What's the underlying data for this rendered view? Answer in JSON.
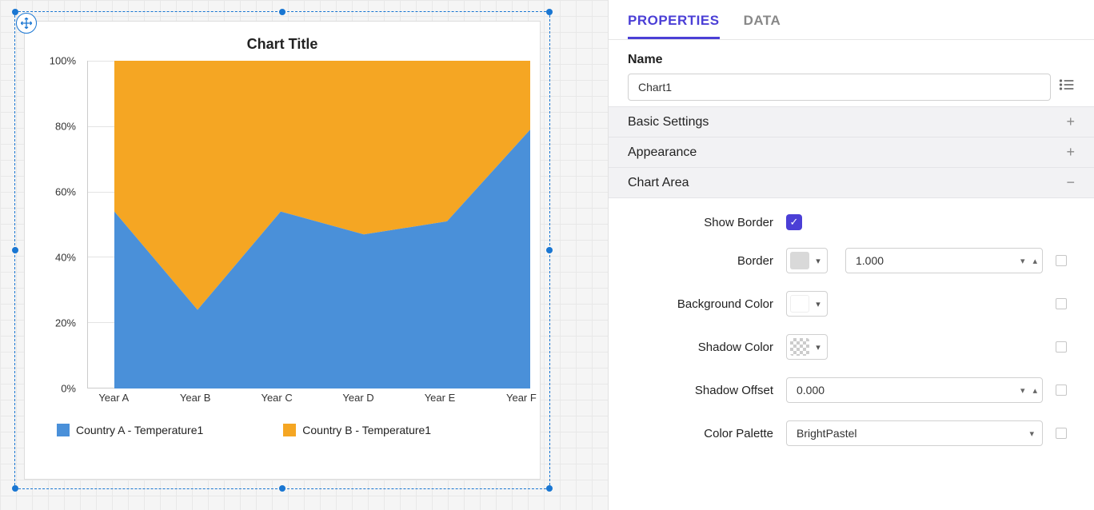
{
  "chart": {
    "title": "Chart Title",
    "y_ticks": [
      "0%",
      "20%",
      "40%",
      "60%",
      "80%",
      "100%"
    ],
    "x_ticks": [
      "Year A",
      "Year B",
      "Year C",
      "Year D",
      "Year E",
      "Year F"
    ],
    "legend": {
      "a": "Country A - Temperature1",
      "b": "Country B - Temperature1"
    }
  },
  "tabs": {
    "properties": "PROPERTIES",
    "data": "DATA"
  },
  "name_section": {
    "label": "Name",
    "value": "Chart1"
  },
  "accordion": {
    "basic": "Basic Settings",
    "appearance": "Appearance",
    "chart_area": "Chart Area"
  },
  "chart_area": {
    "show_border": "Show Border",
    "border": "Border",
    "border_width": "1.000",
    "background_color": "Background Color",
    "shadow_color": "Shadow Color",
    "shadow_offset": "Shadow Offset",
    "shadow_offset_val": "0.000",
    "color_palette": "Color Palette",
    "color_palette_val": "BrightPastel"
  },
  "colors": {
    "series_a": "#4a90d9",
    "series_b": "#f5a623",
    "accent": "#4b3fd6"
  },
  "chart_data": {
    "type": "area",
    "stacked_percent": true,
    "categories": [
      "Year A",
      "Year B",
      "Year C",
      "Year D",
      "Year E",
      "Year F"
    ],
    "series": [
      {
        "name": "Country A - Temperature1",
        "color": "#4a90d9",
        "values": [
          54,
          24,
          54,
          47,
          51,
          79
        ]
      },
      {
        "name": "Country B - Temperature1",
        "color": "#f5a623",
        "values": [
          46,
          76,
          46,
          53,
          49,
          21
        ]
      }
    ],
    "title": "Chart Title",
    "xlabel": "",
    "ylabel": "",
    "ylim": [
      0,
      100
    ],
    "y_ticks": [
      0,
      20,
      40,
      60,
      80,
      100
    ]
  }
}
